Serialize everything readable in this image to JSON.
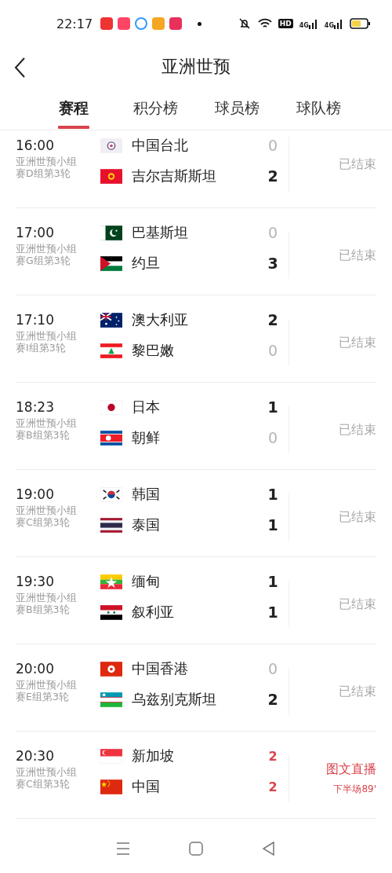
{
  "status_bar": {
    "time": "22:17",
    "network_badges": [
      "HD",
      "4G",
      "4G"
    ]
  },
  "header": {
    "title": "亚洲世预"
  },
  "tabs": [
    {
      "label": "赛程",
      "selected": true
    },
    {
      "label": "积分榜",
      "selected": false
    },
    {
      "label": "球员榜",
      "selected": false
    },
    {
      "label": "球队榜",
      "selected": false
    }
  ],
  "matches": [
    {
      "time": "16:00",
      "competition": "亚洲世预小组赛D组第3轮",
      "kind": "finished",
      "status": "已结束",
      "teams": [
        {
          "kind": "plumflag",
          "name": "中国台北",
          "score": "0",
          "lost": true
        },
        {
          "kind": "kyrgyzstan",
          "name": "吉尔吉斯斯坦",
          "score": "2",
          "lost": false
        }
      ]
    },
    {
      "time": "17:00",
      "competition": "亚洲世预小组赛G组第3轮",
      "kind": "finished",
      "status": "已结束",
      "teams": [
        {
          "kind": "pakistan",
          "name": "巴基斯坦",
          "score": "0",
          "lost": true
        },
        {
          "kind": "jordan",
          "name": "约旦",
          "score": "3",
          "lost": false
        }
      ]
    },
    {
      "time": "17:10",
      "competition": "亚洲世预小组赛I组第3轮",
      "kind": "finished",
      "status": "已结束",
      "teams": [
        {
          "kind": "australia",
          "name": "澳大利亚",
          "score": "2",
          "lost": false
        },
        {
          "kind": "lebanon",
          "name": "黎巴嫩",
          "score": "0",
          "lost": true
        }
      ]
    },
    {
      "time": "18:23",
      "competition": "亚洲世预小组赛B组第3轮",
      "kind": "finished",
      "status": "已结束",
      "teams": [
        {
          "kind": "japan",
          "name": "日本",
          "score": "1",
          "lost": false
        },
        {
          "kind": "dprk",
          "name": "朝鲜",
          "score": "0",
          "lost": true
        }
      ]
    },
    {
      "time": "19:00",
      "competition": "亚洲世预小组赛C组第3轮",
      "kind": "finished",
      "status": "已结束",
      "teams": [
        {
          "kind": "korea",
          "name": "韩国",
          "score": "1",
          "lost": false
        },
        {
          "kind": "thailand",
          "name": "泰国",
          "score": "1",
          "lost": false
        }
      ]
    },
    {
      "time": "19:30",
      "competition": "亚洲世预小组赛B组第3轮",
      "kind": "finished",
      "status": "已结束",
      "teams": [
        {
          "kind": "myanmar",
          "name": "缅甸",
          "score": "1",
          "lost": false
        },
        {
          "kind": "syria",
          "name": "叙利亚",
          "score": "1",
          "lost": false
        }
      ]
    },
    {
      "time": "20:00",
      "competition": "亚洲世预小组赛E组第3轮",
      "kind": "finished",
      "status": "已结束",
      "teams": [
        {
          "kind": "hongkong",
          "name": "中国香港",
          "score": "0",
          "lost": true
        },
        {
          "kind": "uzbekistan",
          "name": "乌兹别克斯坦",
          "score": "2",
          "lost": false
        }
      ]
    },
    {
      "time": "20:30",
      "competition": "亚洲世预小组赛C组第3轮",
      "kind": "live",
      "status": "图文直播",
      "phase": "下半场89'",
      "teams": [
        {
          "kind": "singapore",
          "name": "新加坡",
          "score": "2",
          "lost": false
        },
        {
          "kind": "china",
          "name": "中国",
          "score": "2",
          "lost": false
        }
      ]
    }
  ]
}
